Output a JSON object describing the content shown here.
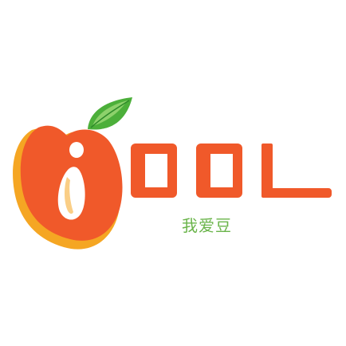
{
  "logo": {
    "wordmark": "iOOL",
    "tagline": "我爱豆",
    "colors": {
      "orange": "#f0592a",
      "orange_shadow": "#f5a623",
      "leaf_green": "#4caf3a",
      "leaf_light": "#8dd16b",
      "tagline_green": "#6ab44a",
      "background": "#ffffff"
    },
    "icons": {
      "fruit": "peach-fruit-icon",
      "leaf": "leaf-icon"
    }
  }
}
